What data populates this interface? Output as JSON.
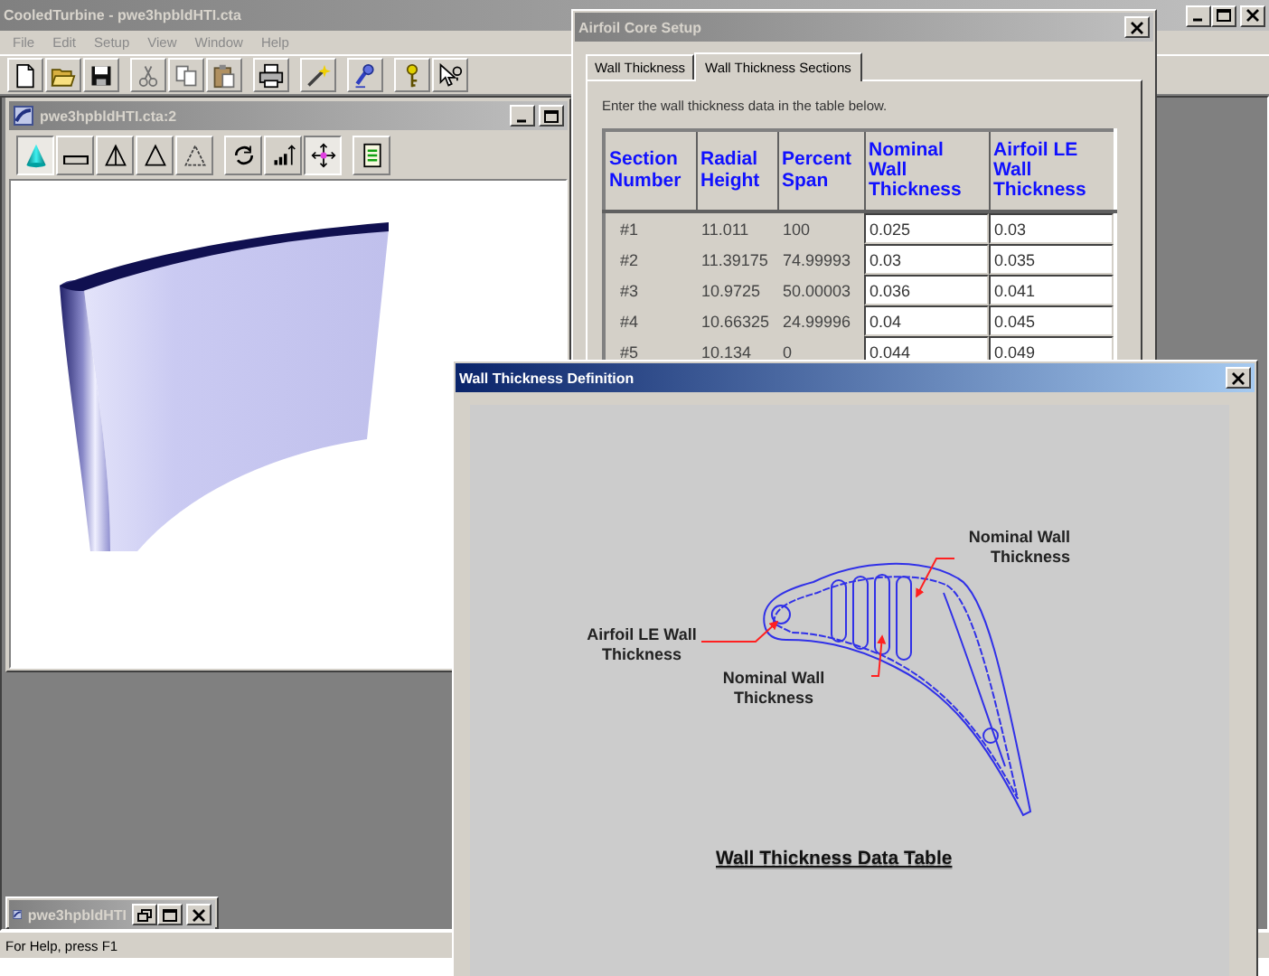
{
  "main_window": {
    "title": "CooledTurbine - pwe3hpbldHTI.cta",
    "active": false
  },
  "menu": [
    "File",
    "Edit",
    "Setup",
    "View",
    "Window",
    "Help"
  ],
  "toolbar": [
    [
      {
        "kind": "new"
      },
      {
        "kind": "open"
      },
      {
        "kind": "save"
      }
    ],
    [
      {
        "kind": "cut"
      },
      {
        "kind": "copy"
      },
      {
        "kind": "paste"
      }
    ],
    [
      {
        "kind": "print"
      }
    ],
    [
      {
        "kind": "wand"
      }
    ],
    [
      {
        "kind": "probe"
      }
    ],
    [
      {
        "kind": "key"
      },
      {
        "kind": "help"
      }
    ]
  ],
  "child_window": {
    "title": "pwe3hpbldHTI.cta:2",
    "active": false,
    "toolbar": [
      [
        {
          "kind": "shaded",
          "pressed": true
        },
        {
          "kind": "flat",
          "pressed": false
        },
        {
          "kind": "wire1",
          "pressed": false
        },
        {
          "kind": "wire2",
          "pressed": false
        },
        {
          "kind": "wire3",
          "pressed": false
        }
      ],
      [
        {
          "kind": "rotate",
          "pressed": false
        },
        {
          "kind": "chart",
          "pressed": false
        },
        {
          "kind": "move",
          "pressed": true
        }
      ],
      [
        {
          "kind": "notes",
          "pressed": false
        }
      ]
    ]
  },
  "minimized_window": {
    "title": "pwe3hpbldHTI"
  },
  "status_bar": "For Help, press F1",
  "setup_dialog": {
    "title": "Airfoil Core Setup",
    "active": false,
    "tabs": [
      {
        "label": "Wall Thickness",
        "selected": false
      },
      {
        "label": "Wall Thickness Sections",
        "selected": true
      }
    ],
    "instruction": "Enter the wall thickness data in the table below.",
    "table": {
      "columns": [
        {
          "label": "Section Number",
          "kind": "text"
        },
        {
          "label": "Radial Height",
          "kind": "text"
        },
        {
          "label": "Percent Span",
          "kind": "text"
        },
        {
          "label": "Nominal Wall Thickness",
          "kind": "input"
        },
        {
          "label": "Airfoil LE Wall Thickness",
          "kind": "input"
        }
      ],
      "rows": [
        [
          "#1",
          "11.011",
          "100",
          "0.025",
          "0.03"
        ],
        [
          "#2",
          "11.39175",
          "74.99993",
          "0.03",
          "0.035"
        ],
        [
          "#3",
          "10.9725",
          "50.00003",
          "0.036",
          "0.041"
        ],
        [
          "#4",
          "10.66325",
          "24.99996",
          "0.04",
          "0.045"
        ],
        [
          "#5",
          "10.134",
          "0",
          "0.044",
          "0.049"
        ]
      ]
    }
  },
  "definition_window": {
    "title": "Wall Thickness Definition",
    "active": true,
    "callouts": [
      "Nominal Wall Thickness",
      "Airfoil LE Wall Thickness",
      "Nominal Wall Thickness"
    ],
    "link": "Wall Thickness Data Table"
  }
}
